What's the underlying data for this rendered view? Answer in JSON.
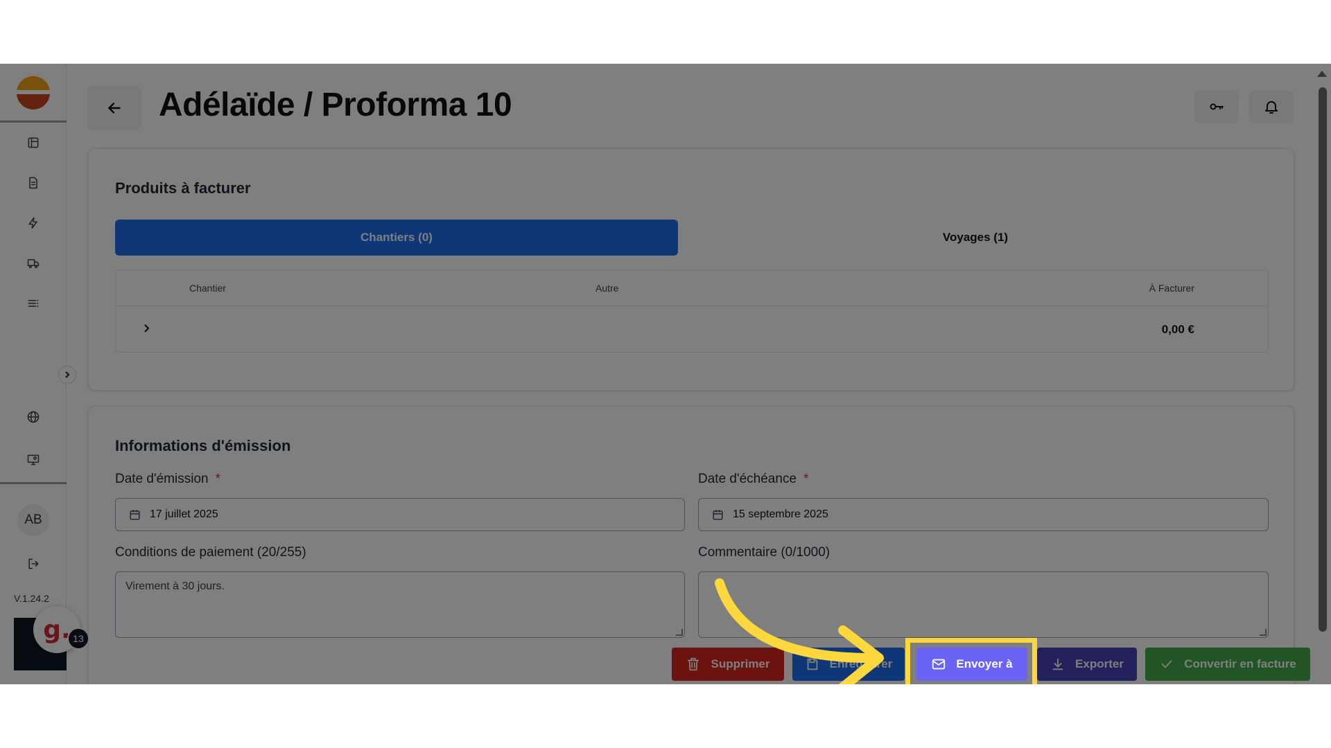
{
  "page": {
    "title": "Adélaïde / Proforma 10",
    "version": "V.1.24.2"
  },
  "sidebar": {
    "avatar_initials": "AB",
    "icons": [
      "layout-icon",
      "document-icon",
      "bolt-icon",
      "truck-icon",
      "list-icon",
      "globe-icon",
      "monitor-user-icon",
      "logout-icon"
    ]
  },
  "header": {
    "key_icon": "key-icon",
    "bell_icon": "bell-icon"
  },
  "products": {
    "title": "Produits à facturer",
    "tabs": [
      {
        "label": "Chantiers (0)",
        "active": true
      },
      {
        "label": "Voyages (1)",
        "active": false
      }
    ],
    "columns": [
      "Chantier",
      "Autre",
      "À Facturer"
    ],
    "rows": [
      {
        "chantier": "",
        "autre": "",
        "a_facturer": "0,00 €"
      }
    ]
  },
  "emission": {
    "title": "Informations d'émission",
    "date_emission_label": "Date d'émission",
    "date_emission_value": "17 juillet 2025",
    "date_echeance_label": "Date d'échéance",
    "date_echeance_value": "15 septembre 2025",
    "required_mark": "*",
    "conditions_label": "Conditions de paiement (20/255)",
    "conditions_value": "Virement à 30 jours.",
    "commentaire_label": "Commentaire (0/1000)",
    "commentaire_value": ""
  },
  "actions": {
    "delete": "Supprimer",
    "save": "Enregistrer",
    "send": "Envoyer à",
    "export": "Exporter",
    "convert": "Convertir en facture"
  },
  "widget": {
    "letter": "g.",
    "badge_count": "13"
  },
  "colors": {
    "primary": "#1e6ff0",
    "delete": "#d9241f",
    "save": "#1e6ff0",
    "send": "#6a63f6",
    "export": "#4840b8",
    "convert": "#45a94a",
    "highlight": "#fcd73e"
  }
}
